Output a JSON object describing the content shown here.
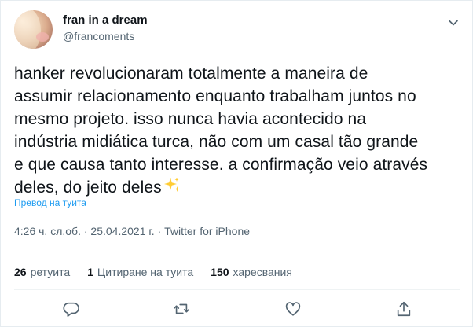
{
  "author": {
    "name": "fran in a dream",
    "handle": "@francoments"
  },
  "menu_icon": "chevron-down-icon",
  "tweet": {
    "lines": [
      "hanker revolucionaram totalmente a maneira de",
      "assumir relacionamento enquanto trabalham juntos no",
      "mesmo projeto. isso nunca havia acontecido na",
      "indústria midiática turca, não com um casal tão grande",
      "e que causa tanto interesse. a confirmação veio através",
      "deles, do jeito deles"
    ],
    "emoji": "sparkles-emoji",
    "translate_label": "Превод на туита"
  },
  "meta": {
    "text": "4:26 ч. сл.об. · 25.04.2021 г. · Twitter for iPhone"
  },
  "stats": {
    "retweets_count": "26",
    "retweets_label": "ретуита",
    "quotes_count": "1",
    "quotes_label": "Цитиране на туита",
    "likes_count": "150",
    "likes_label": "харесвания"
  },
  "actions": [
    "reply-icon",
    "retweet-icon",
    "like-icon",
    "share-icon"
  ],
  "colors": {
    "text": "#0f1419",
    "secondary": "#536471",
    "link": "#1d9bf0",
    "divider": "#eff3f4"
  }
}
